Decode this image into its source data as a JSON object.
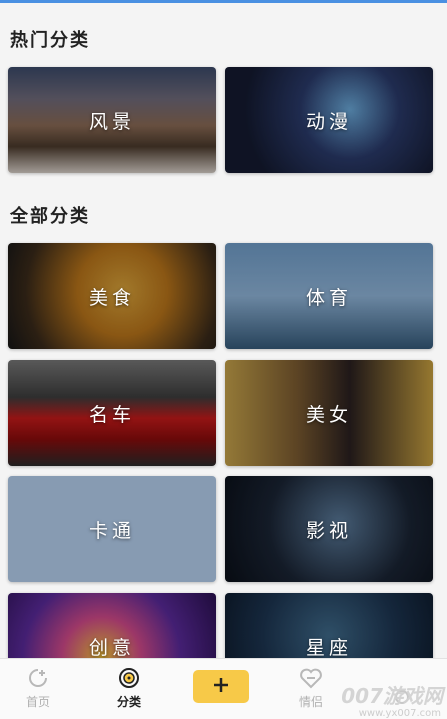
{
  "sections": {
    "hot_title": "热门分类",
    "all_title": "全部分类"
  },
  "hot_categories": [
    {
      "label": "风景",
      "icon": "scenery-photo"
    },
    {
      "label": "动漫",
      "icon": "anime-photo"
    }
  ],
  "all_categories": [
    {
      "label": "美食",
      "icon": "food-photo"
    },
    {
      "label": "体育",
      "icon": "sports-photo"
    },
    {
      "label": "名车",
      "icon": "car-photo"
    },
    {
      "label": "美女",
      "icon": "beauty-photo"
    },
    {
      "label": "卡通",
      "icon": "cartoon-photo"
    },
    {
      "label": "影视",
      "icon": "film-photo"
    },
    {
      "label": "创意",
      "icon": "creative-photo"
    },
    {
      "label": "星座",
      "icon": "zodiac-photo"
    }
  ],
  "tabbar": {
    "home": "首页",
    "category": "分类",
    "add_icon": "plus-icon",
    "love": "情侣",
    "active_tab": "category",
    "accent_color": "#f7c948"
  },
  "watermark": {
    "text": "007游戏网",
    "url": "www.yx007.com"
  }
}
